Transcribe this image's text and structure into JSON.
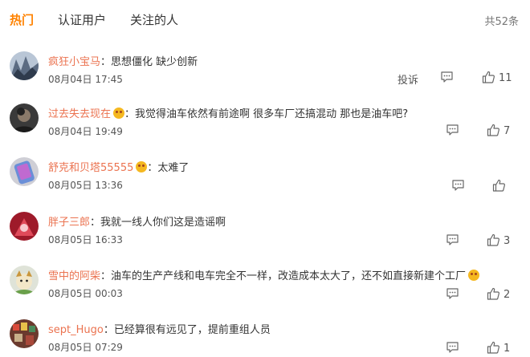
{
  "tabs": [
    {
      "label": "热门",
      "active": true
    },
    {
      "label": "认证用户",
      "active": false
    },
    {
      "label": "关注的人",
      "active": false
    }
  ],
  "total_count": "共52条",
  "icons": {
    "reply": "comment-icon",
    "like": "thumbs-up-icon",
    "emoji": "emoji-icon"
  },
  "colors": {
    "accent": "#ff8200",
    "username": "#eb7350"
  },
  "comments": [
    {
      "user": "疯狂小宝马",
      "separator": "：",
      "emoji": false,
      "text": "思想僵化 缺少创新",
      "time": "08月04日 17:45",
      "report": "投诉",
      "likes": "11"
    },
    {
      "user": "过去失去现在",
      "separator": "：",
      "emoji": true,
      "text": "我觉得油车依然有前途啊 很多车厂还搞混动 那也是油车吧?",
      "time": "08月04日 19:49",
      "report": "",
      "likes": "7"
    },
    {
      "user": "舒克和贝塔55555",
      "separator": "：",
      "emoji": true,
      "text": "太难了",
      "time": "08月05日 13:36",
      "report": "",
      "likes": ""
    },
    {
      "user": "胖子三郎",
      "separator": "：",
      "emoji": false,
      "text": "我就一线人你们这是造谣啊",
      "time": "08月05日 16:33",
      "report": "",
      "likes": "3"
    },
    {
      "user": "雪中的阿柴",
      "separator": "：",
      "emoji": false,
      "text": "油车的生产产线和电车完全不一样，改造成本太大了，还不如直接新建个工厂",
      "trailing_emoji": true,
      "time": "08月05日 00:03",
      "report": "",
      "likes": "2"
    },
    {
      "user": "sept_Hugo",
      "separator": "：",
      "emoji": false,
      "text": "已经算很有远见了，提前重组人员",
      "time": "08月05日 07:29",
      "report": "",
      "likes": "1"
    }
  ]
}
